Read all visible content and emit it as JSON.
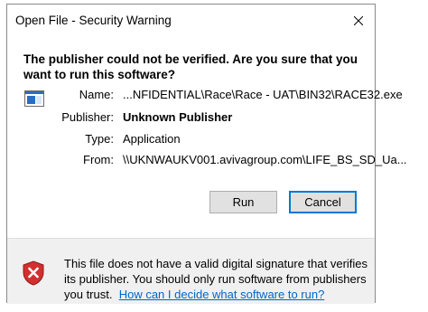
{
  "window": {
    "title": "Open File - Security Warning"
  },
  "heading": "The publisher could not be verified. Are you sure that you want to run this software?",
  "details": {
    "name_label": "Name:",
    "name_value": "...NFIDENTIAL\\Race\\Race - UAT\\BIN32\\RACE32.exe",
    "publisher_label": "Publisher:",
    "publisher_value": "Unknown Publisher",
    "type_label": "Type:",
    "type_value": "Application",
    "from_label": "From:",
    "from_value": "\\\\UKNWAUKV001.avivagroup.com\\LIFE_BS_SD_Ua..."
  },
  "buttons": {
    "run": "Run",
    "cancel": "Cancel"
  },
  "footer": {
    "text": "This file does not have a valid digital signature that verifies its publisher. You should only run software from publishers you trust.",
    "link": "How can I decide what software to run?"
  },
  "icons": {
    "app": "application-window-icon",
    "close": "close-icon",
    "warning": "shield-warning-icon"
  },
  "colors": {
    "link": "#0066cc",
    "shield_red": "#d32f2f",
    "default_button_border": "#0078d7",
    "footer_bg": "#f0f0f0"
  }
}
